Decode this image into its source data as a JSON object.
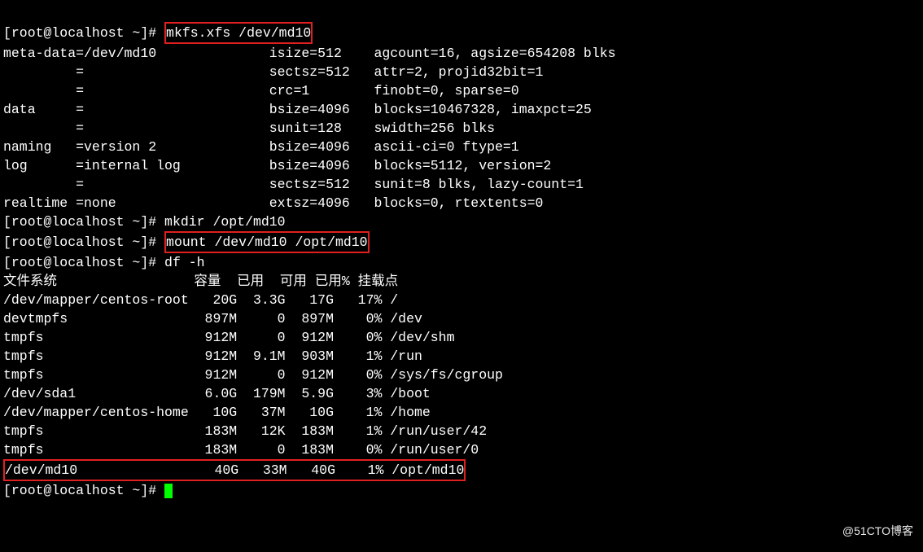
{
  "prompt": "[root@localhost ~]# ",
  "cmd1": "mkfs.xfs /dev/md10",
  "mkfs": {
    "l1": "meta-data=/dev/md10              isize=512    agcount=16, agsize=654208 blks",
    "l2": "         =                       sectsz=512   attr=2, projid32bit=1",
    "l3": "         =                       crc=1        finobt=0, sparse=0",
    "l4": "data     =                       bsize=4096   blocks=10467328, imaxpct=25",
    "l5": "         =                       sunit=128    swidth=256 blks",
    "l6": "naming   =version 2              bsize=4096   ascii-ci=0 ftype=1",
    "l7": "log      =internal log           bsize=4096   blocks=5112, version=2",
    "l8": "         =                       sectsz=512   sunit=8 blks, lazy-count=1",
    "l9": "realtime =none                   extsz=4096   blocks=0, rtextents=0"
  },
  "cmd2": "mkdir /opt/md10",
  "cmd3": "mount /dev/md10 /opt/md10",
  "cmd4": "df -h",
  "df": {
    "hdr": "文件系统                 容量  已用  可用 已用% 挂载点",
    "r1": "/dev/mapper/centos-root   20G  3.3G   17G   17% /",
    "r2": "devtmpfs                 897M     0  897M    0% /dev",
    "r3": "tmpfs                    912M     0  912M    0% /dev/shm",
    "r4": "tmpfs                    912M  9.1M  903M    1% /run",
    "r5": "tmpfs                    912M     0  912M    0% /sys/fs/cgroup",
    "r6": "/dev/sda1                6.0G  179M  5.9G    3% /boot",
    "r7": "/dev/mapper/centos-home   10G   37M   10G    1% /home",
    "r8": "tmpfs                    183M   12K  183M    1% /run/user/42",
    "r9": "tmpfs                    183M     0  183M    0% /run/user/0",
    "r10": "/dev/md10                 40G   33M   40G    1% /opt/md10"
  },
  "chart_data": {
    "type": "table",
    "title": "df -h output",
    "columns": [
      "文件系统",
      "容量",
      "已用",
      "可用",
      "已用%",
      "挂载点"
    ],
    "rows": [
      [
        "/dev/mapper/centos-root",
        "20G",
        "3.3G",
        "17G",
        "17%",
        "/"
      ],
      [
        "devtmpfs",
        "897M",
        "0",
        "897M",
        "0%",
        "/dev"
      ],
      [
        "tmpfs",
        "912M",
        "0",
        "912M",
        "0%",
        "/dev/shm"
      ],
      [
        "tmpfs",
        "912M",
        "9.1M",
        "903M",
        "1%",
        "/run"
      ],
      [
        "tmpfs",
        "912M",
        "0",
        "912M",
        "0%",
        "/sys/fs/cgroup"
      ],
      [
        "/dev/sda1",
        "6.0G",
        "179M",
        "5.9G",
        "3%",
        "/boot"
      ],
      [
        "/dev/mapper/centos-home",
        "10G",
        "37M",
        "10G",
        "1%",
        "/home"
      ],
      [
        "tmpfs",
        "183M",
        "12K",
        "183M",
        "1%",
        "/run/user/42"
      ],
      [
        "tmpfs",
        "183M",
        "0",
        "183M",
        "0%",
        "/run/user/0"
      ],
      [
        "/dev/md10",
        "40G",
        "33M",
        "40G",
        "1%",
        "/opt/md10"
      ]
    ]
  },
  "watermark": "@51CTO博客"
}
